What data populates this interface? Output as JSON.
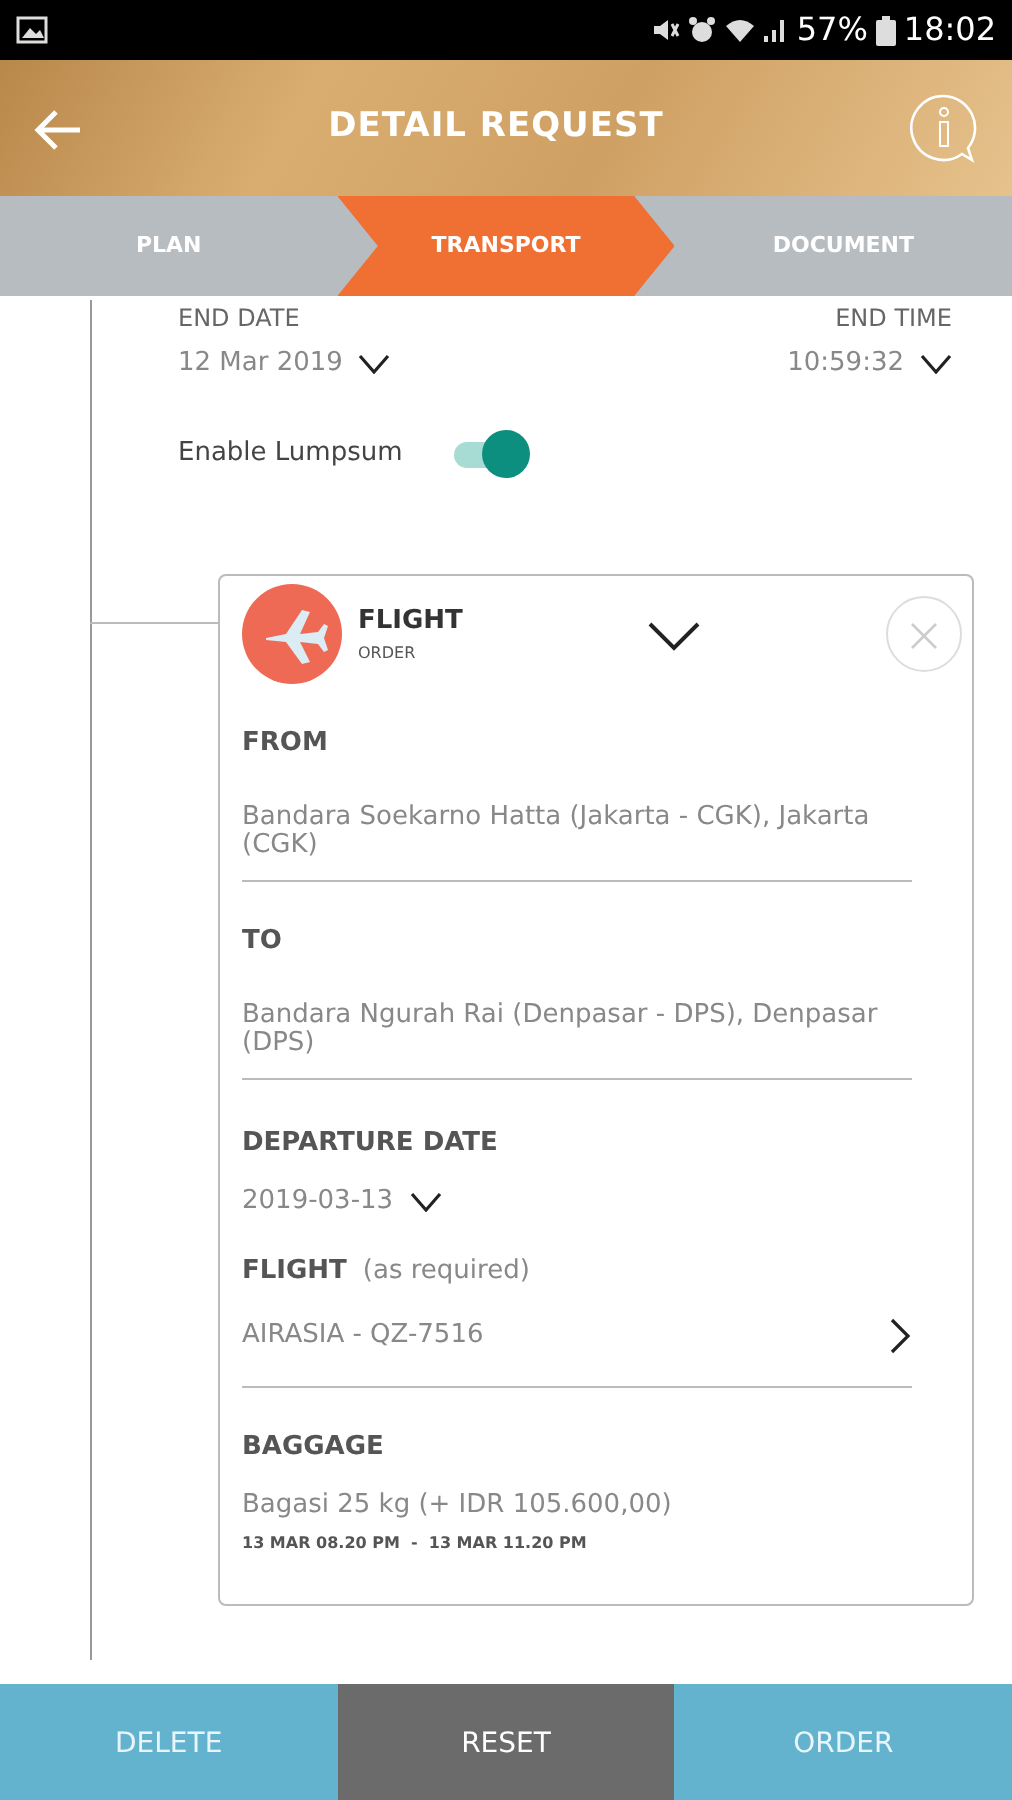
{
  "status_bar": {
    "battery": "57%",
    "time": "18:02"
  },
  "header": {
    "title": "DETAIL REQUEST"
  },
  "steps": [
    {
      "label": "PLAN",
      "selected": false
    },
    {
      "label": "TRANSPORT",
      "selected": true
    },
    {
      "label": "DOCUMENT",
      "selected": false
    }
  ],
  "end": {
    "date_label": "END DATE",
    "time_label": "END TIME",
    "date": "12 Mar 2019",
    "time": "10:59:32"
  },
  "lumpsum": {
    "label": "Enable Lumpsum",
    "on": true
  },
  "order_card": {
    "title": "FLIGHT",
    "subtitle": "ORDER",
    "fields": [
      {
        "kind": "text",
        "label": "FROM",
        "value": "Bandara Soekarno Hatta (Jakarta - CGK), Jakarta (CGK)"
      },
      {
        "kind": "text",
        "label": "TO",
        "value": "Bandara Ngurah Rai (Denpasar - DPS), Denpasar (DPS)"
      },
      {
        "kind": "date",
        "label": "DEPARTURE DATE",
        "value": "2019-03-13"
      },
      {
        "kind": "select",
        "label": "FLIGHT",
        "hint": "(as required)",
        "value": "AIRASIA - QZ-7516"
      },
      {
        "kind": "baggage",
        "label": "BAGGAGE",
        "value": "Bagasi 25 kg (+ IDR 105.600,00)",
        "note": "13 MAR 08.20 PM  -  13 MAR 11.20 PM"
      }
    ]
  },
  "buttons": [
    {
      "label": "DELETE",
      "kind": "secondary"
    },
    {
      "label": "RESET",
      "kind": "dark"
    },
    {
      "label": "ORDER",
      "kind": "primary"
    }
  ]
}
